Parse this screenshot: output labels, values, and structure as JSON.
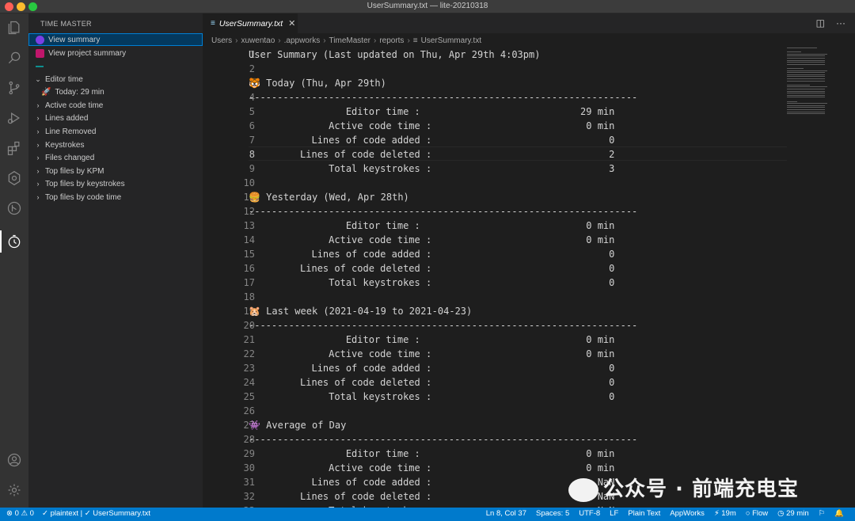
{
  "window": {
    "title": "UserSummary.txt — lite-20210318"
  },
  "sidebar": {
    "title": "TIME MASTER",
    "items": [
      {
        "label": "View summary"
      },
      {
        "label": "View project summary"
      }
    ],
    "tree": [
      {
        "label": "Editor time",
        "expanded": true
      },
      {
        "label": "Today:  29 min",
        "child": true
      },
      {
        "label": "Active code time"
      },
      {
        "label": "Lines added"
      },
      {
        "label": "Line Removed"
      },
      {
        "label": "Keystrokes"
      },
      {
        "label": "Files changed"
      },
      {
        "label": "Top files by KPM"
      },
      {
        "label": "Top files by keystrokes"
      },
      {
        "label": "Top files by code time"
      }
    ]
  },
  "tab": {
    "name": "UserSummary.txt"
  },
  "breadcrumb": [
    "Users",
    "xuwentao",
    ".appworks",
    "TimeMaster",
    "reports",
    "UserSummary.txt"
  ],
  "editor": {
    "lines": [
      "User Summary (Last updated on Thu, Apr 29th 4:03pm)",
      "",
      "🐯 Today (Thu, Apr 29th)",
      "--------------------------------------------------------------------",
      "                 Editor time :                            29 min",
      "              Active code time :                           0 min",
      "           Lines of code added :                               0",
      "         Lines of code deleted :                               2",
      "              Total keystrokes :                               3",
      "",
      "🍔 Yesterday (Wed, Apr 28th)",
      "--------------------------------------------------------------------",
      "                 Editor time :                             0 min",
      "              Active code time :                           0 min",
      "           Lines of code added :                               0",
      "         Lines of code deleted :                               0",
      "              Total keystrokes :                               0",
      "",
      "🐹 Last week (2021-04-19 to 2021-04-23)",
      "--------------------------------------------------------------------",
      "                 Editor time :                             0 min",
      "              Active code time :                           0 min",
      "           Lines of code added :                               0",
      "         Lines of code deleted :                               0",
      "              Total keystrokes :                               0",
      "",
      "👾 Average of Day",
      "--------------------------------------------------------------------",
      "                 Editor time :                             0 min",
      "              Active code time :                           0 min",
      "           Lines of code added :                             NaN",
      "         Lines of code deleted :                             NaN",
      "              Total keystrokes :                             NaN"
    ]
  },
  "watermark": "公众号 · 前端充电宝",
  "status": {
    "left": [
      "⊗ 0 ⚠ 0",
      "✓ plaintext | ✓ UserSummary.txt"
    ],
    "right": [
      "Ln 8, Col 37",
      "Spaces: 5",
      "UTF-8",
      "LF",
      "Plain Text",
      "AppWorks",
      "⚡ 19m",
      "○ Flow",
      "◷ 29 min",
      "⚐",
      "🔔"
    ]
  }
}
